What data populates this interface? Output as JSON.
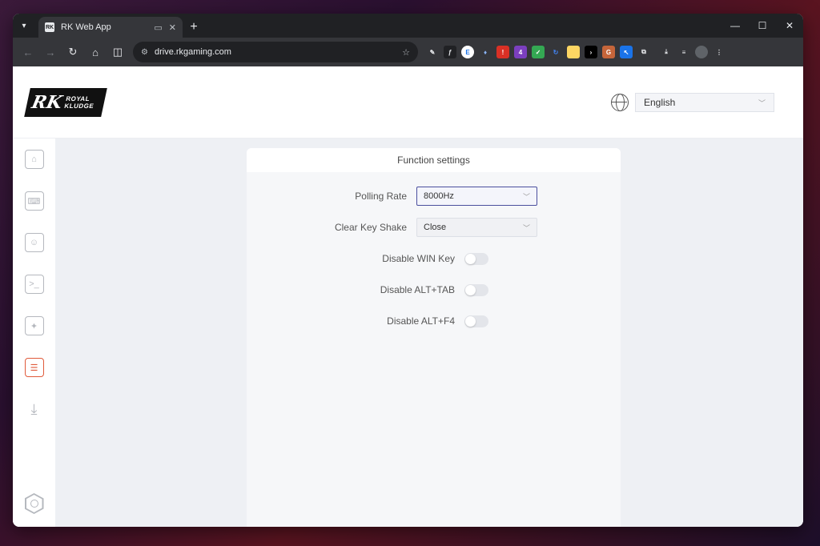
{
  "browser": {
    "tab_title": "RK Web App",
    "url": "drive.rkgaming.com",
    "controls": {
      "minimize": "—",
      "maximize": "☐",
      "close": "✕"
    }
  },
  "header": {
    "logo_mark": "RK",
    "logo_line1": "ROYAL",
    "logo_line2": "KLUDGE",
    "language": "English"
  },
  "sidebar": {
    "items": [
      {
        "name": "home-icon",
        "glyph": "⌂"
      },
      {
        "name": "keyboard-icon",
        "glyph": "⌨"
      },
      {
        "name": "user-settings-icon",
        "glyph": "☺"
      },
      {
        "name": "terminal-icon",
        "glyph": ">_"
      },
      {
        "name": "lightbulb-icon",
        "glyph": "✦"
      },
      {
        "name": "sliders-icon",
        "glyph": "☰",
        "active": true
      },
      {
        "name": "download-icon",
        "glyph": "↓"
      }
    ]
  },
  "panel": {
    "title": "Function settings",
    "polling_rate_label": "Polling Rate",
    "polling_rate_value": "8000Hz",
    "clear_key_shake_label": "Clear Key Shake",
    "clear_key_shake_value": "Close",
    "toggles": [
      {
        "label": "Disable WIN Key",
        "on": false
      },
      {
        "label": "Disable ALT+TAB",
        "on": false
      },
      {
        "label": "Disable ALT+F4",
        "on": false
      }
    ]
  },
  "colors": {
    "accent": "#e05a3a",
    "focus": "#4b4f9e"
  }
}
